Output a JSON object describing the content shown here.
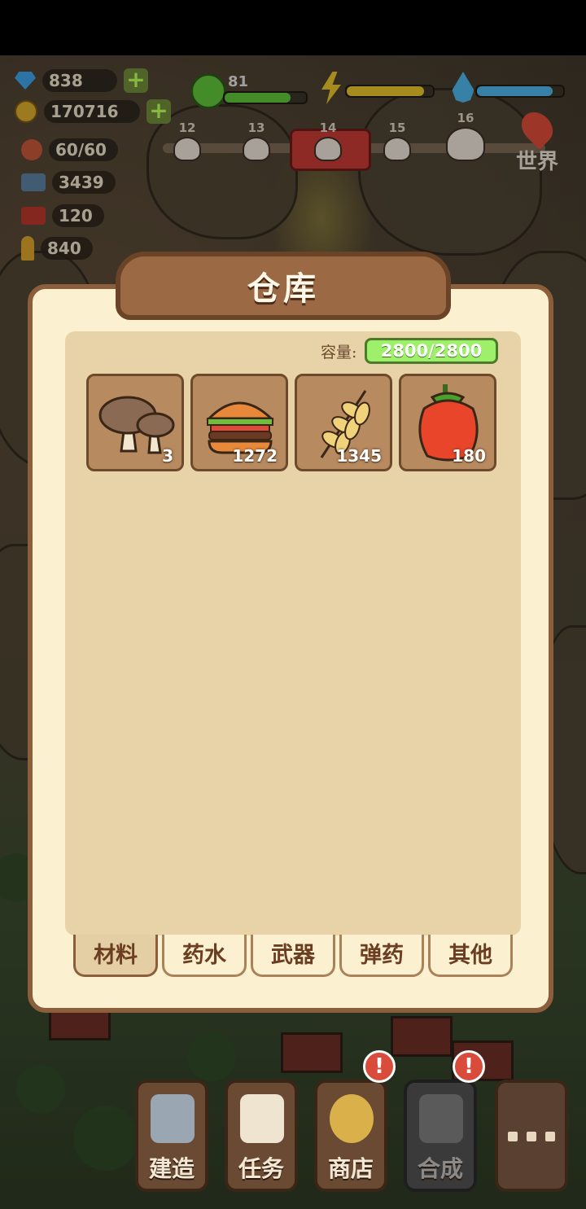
{
  "hud": {
    "gems": "838",
    "coins": "170716",
    "population": "60/60",
    "ammo_rifle": "3439",
    "ammo_shells": "120",
    "ammo_bullets": "840",
    "hunger": "81",
    "bar_fill": {
      "hunger": 0.81,
      "energy": 0.9,
      "water": 0.88
    },
    "world_label": "世界",
    "levels": [
      "12",
      "13",
      "14",
      "15",
      "16"
    ],
    "current_level": "14"
  },
  "warehouse": {
    "title": "仓库",
    "capacity_label": "容量:",
    "capacity_value": "2800/2800",
    "items": [
      {
        "name": "mushroom",
        "qty": "3"
      },
      {
        "name": "burger",
        "qty": "1272"
      },
      {
        "name": "wheat",
        "qty": "1345"
      },
      {
        "name": "bell-pepper",
        "qty": "180"
      }
    ],
    "tabs": [
      "材料",
      "药水",
      "武器",
      "弹药",
      "其他"
    ],
    "active_tab": "材料"
  },
  "nav": {
    "build": "建造",
    "tasks": "任务",
    "shop": "商店",
    "craft": "合成",
    "alert_glyph": "!",
    "more_icon": "more-icon"
  },
  "colors": {
    "panel_bg": "#fbf0cf",
    "panel_border": "#8b5e3c",
    "capacity_bar": "#9ef06a",
    "alert": "#d94b3a"
  }
}
